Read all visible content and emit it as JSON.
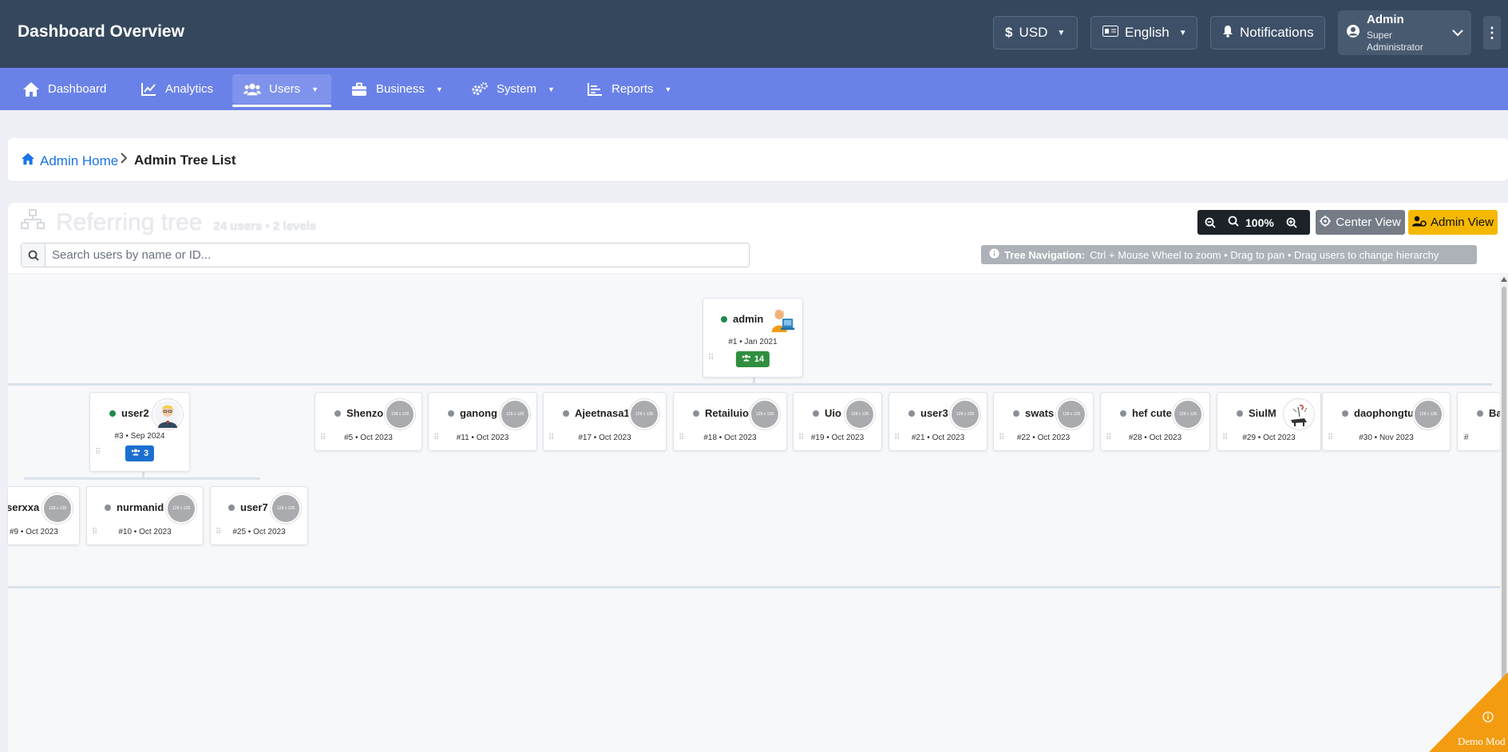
{
  "header": {
    "title": "Dashboard Overview",
    "currency": "USD",
    "language": "English",
    "notifications": "Notifications",
    "user_name": "Admin",
    "user_role": "Super Administrator"
  },
  "nav": {
    "items": [
      {
        "label": "Dashboard",
        "icon": "home-icon"
      },
      {
        "label": "Analytics",
        "icon": "chart-line-icon"
      },
      {
        "label": "Users",
        "icon": "users-icon",
        "active": true
      },
      {
        "label": "Business",
        "icon": "briefcase-icon"
      },
      {
        "label": "System",
        "icon": "cogs-icon"
      },
      {
        "label": "Reports",
        "icon": "report-icon"
      }
    ]
  },
  "breadcrumb": {
    "home": "Admin Home",
    "current": "Admin Tree List"
  },
  "panel": {
    "title": "Referring tree",
    "subtitle": "24 users • 2 levels",
    "search_placeholder": "Search users by name or ID...",
    "zoom": "100%",
    "center_view": "Center View",
    "admin_view": "Admin View",
    "hint_title": "Tree Navigation:",
    "hint_text": "Ctrl + Mouse Wheel to zoom • Drag to pan • Drag users to change hierarchy"
  },
  "avatar_placeholder": "128 x 128",
  "tree": {
    "root": {
      "name": "admin",
      "meta": "#1 • Jan 2021",
      "badge": "14",
      "online": true
    },
    "level1": [
      {
        "name": "user2",
        "meta": "#3 • Sep 2024",
        "badge": "3",
        "online": true
      },
      {
        "name": "Shenzo",
        "meta": "#5 • Oct 2023"
      },
      {
        "name": "ganong",
        "meta": "#11 • Oct 2023"
      },
      {
        "name": "Ajeetnasa1",
        "meta": "#17 • Oct 2023"
      },
      {
        "name": "Retailuio",
        "meta": "#18 • Oct 2023"
      },
      {
        "name": "Uio",
        "meta": "#19 • Oct 2023"
      },
      {
        "name": "user3",
        "meta": "#21 • Oct 2023"
      },
      {
        "name": "swats",
        "meta": "#22 • Oct 2023"
      },
      {
        "name": "hef cute",
        "meta": "#28 • Oct 2023"
      },
      {
        "name": "SiulM",
        "meta": "#29 • Oct 2023"
      },
      {
        "name": "daophongtu",
        "meta": "#30 • Nov 2023"
      },
      {
        "name": "Ba",
        "meta": "#"
      }
    ],
    "level2": [
      {
        "name": "serxxa",
        "meta": "#9 • Oct 2023"
      },
      {
        "name": "nurmanid",
        "meta": "#10 • Oct 2023"
      },
      {
        "name": "user7",
        "meta": "#25 • Oct 2023"
      }
    ]
  },
  "demo_label": "Demo Mod",
  "colors": {
    "header_bg": "#35475d",
    "nav_bg": "#6a82e8",
    "accent_blue": "#1a73e8",
    "online": "#1f8a4c",
    "badge_green": "#2f8f3e",
    "badge_blue": "#1c6fd0",
    "admin_view": "#f5b800",
    "demo_ribbon": "#f39c12"
  }
}
